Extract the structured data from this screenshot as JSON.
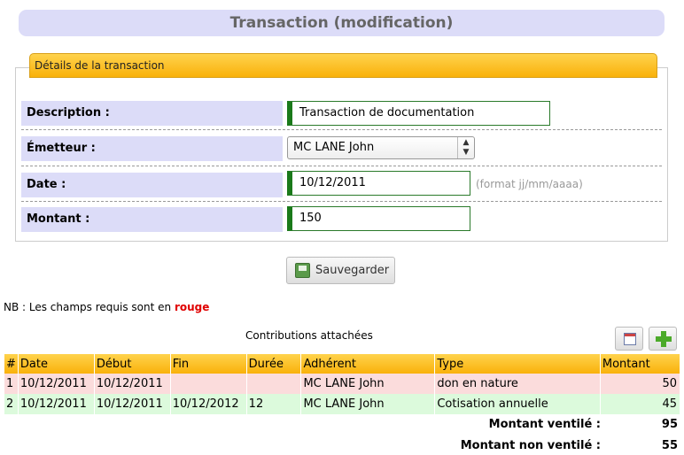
{
  "page": {
    "title": "Transaction (modification)"
  },
  "form": {
    "legend": "Détails de la transaction",
    "description": {
      "label": "Description :",
      "value": "Transaction de documentation"
    },
    "emetteur": {
      "label": "Émetteur :",
      "value": "MC LANE John"
    },
    "date": {
      "label": "Date :",
      "value": "10/12/2011",
      "hint": "(format jj/mm/aaaa)"
    },
    "montant": {
      "label": "Montant :",
      "value": "150"
    },
    "save_label": "Sauvegarder"
  },
  "note": {
    "prefix": "NB : Les champs requis sont en",
    "highlight": "rouge"
  },
  "contributions": {
    "title": "Contributions attachées",
    "columns": [
      "#",
      "Date",
      "Début",
      "Fin",
      "Durée",
      "Adhérent",
      "Type",
      "Montant"
    ],
    "rows": [
      [
        "1",
        "10/12/2011",
        "10/12/2011",
        "",
        "",
        "MC LANE John",
        "don en nature",
        "50"
      ],
      [
        "2",
        "10/12/2011",
        "10/12/2011",
        "10/12/2012",
        "12",
        "MC LANE John",
        "Cotisation annuelle",
        "45"
      ]
    ],
    "totals": {
      "ventile_label": "Montant ventilé :",
      "ventile_value": "95",
      "non_ventile_label": "Montant non ventilé :",
      "non_ventile_value": "55"
    }
  },
  "colors": {
    "required_accent": "#1a7a1a",
    "header_orange": "#f9b10a",
    "label_bg": "#dcdcf8",
    "row_red": "#fbdcdc",
    "row_green": "#dcfadc"
  },
  "icons": {
    "save": "save-icon",
    "calendar": "calendar-icon",
    "add": "plus-icon"
  }
}
